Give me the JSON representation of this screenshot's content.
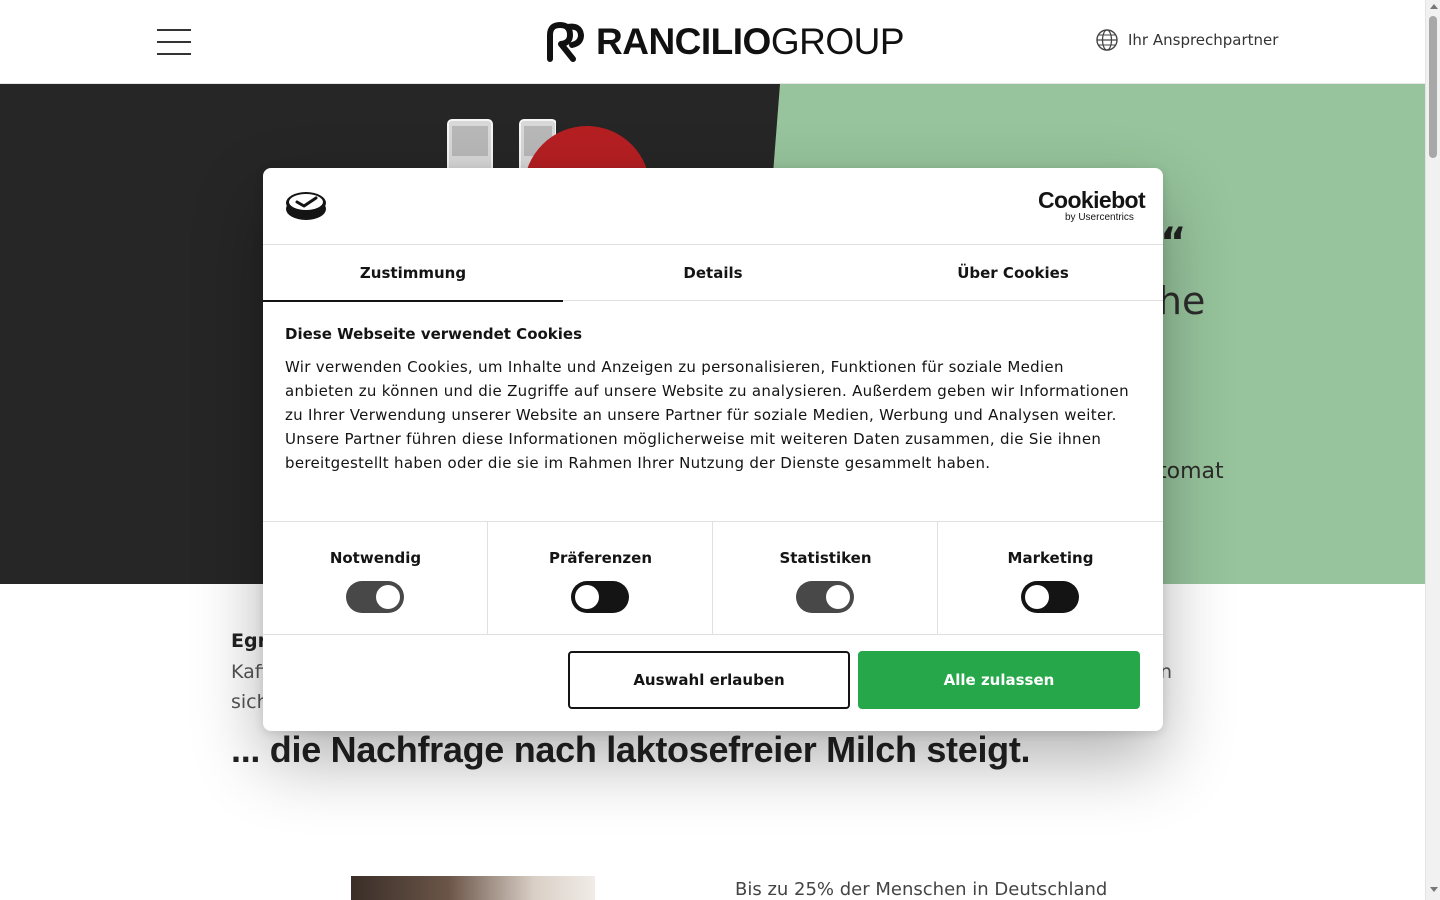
{
  "header": {
    "logo_bold": "RANCILIO",
    "logo_light": "GROUP",
    "contact_label": "Ihr Ansprechpartner"
  },
  "hero": {
    "text_1": "e“",
    "text_2": "che",
    "text_3": "tomat",
    "colors": {
      "dark": "#262626",
      "green": "#97c49c",
      "accent_red": "#b51f22"
    }
  },
  "content": {
    "bold_fragment": "Egr",
    "line1_start": "Kaff",
    "line1_end": "n",
    "line2_start": "sich",
    "headline": "... die Nachfrage nach laktosefreier Milch steigt.",
    "stat_text": "Bis zu 25% der Menschen in Deutschland"
  },
  "cookie_dialog": {
    "brand": "Cookiebot",
    "brand_sub": "by Usercentrics",
    "tabs": [
      {
        "label": "Zustimmung",
        "active": true
      },
      {
        "label": "Details",
        "active": false
      },
      {
        "label": "Über Cookies",
        "active": false
      }
    ],
    "title": "Diese Webseite verwendet Cookies",
    "body": "Wir verwenden Cookies, um Inhalte und Anzeigen zu personalisieren, Funktionen für soziale Medien anbieten zu können und die Zugriffe auf unsere Website zu analysieren. Außerdem geben wir Informationen zu Ihrer Verwendung unserer Website an unsere Partner für soziale Medien, Werbung und Analysen weiter. Unsere Partner führen diese Informationen möglicherweise mit weiteren Daten zusammen, die Sie ihnen bereitgestellt haben oder die sie im Rahmen Ihrer Nutzung der Dienste gesammelt haben.",
    "toggles": [
      {
        "label": "Notwendig",
        "checked": true
      },
      {
        "label": "Präferenzen",
        "checked": false
      },
      {
        "label": "Statistiken",
        "checked": true
      },
      {
        "label": "Marketing",
        "checked": false
      }
    ],
    "buttons": {
      "allow_selection": "Auswahl erlauben",
      "allow_all": "Alle zulassen"
    },
    "colors": {
      "primary_green": "#26a84a",
      "text": "#141414"
    }
  },
  "icons": {
    "menu": "hamburger-menu-icon",
    "contact": "globe-icon",
    "dialog": "cookie-icon"
  }
}
